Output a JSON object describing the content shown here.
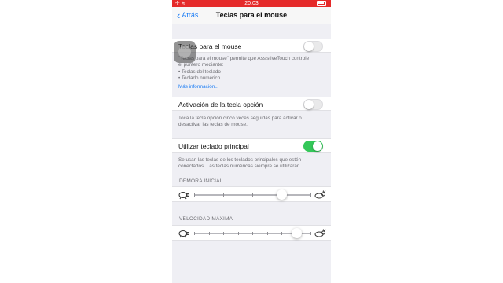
{
  "status_bar": {
    "time": "20:03",
    "left_icons": "✈ ≋"
  },
  "nav": {
    "back_label": "Atrás",
    "title": "Teclas para el mouse"
  },
  "mouse_keys": {
    "label": "Teclas para el mouse",
    "enabled": false,
    "footer_lines": [
      "\"Teclas para el mouse\" permite que AssistiveTouch controle",
      "el puntero mediante:",
      "•  Teclas del teclado",
      "•  Teclado numérico"
    ],
    "more_info_link": "Más información..."
  },
  "option_key": {
    "label": "Activación de la tecla opción",
    "enabled": false,
    "footer_lines": [
      "Toca la tecla opción cinco veces seguidas para activar o",
      "desactivar las teclas de mouse."
    ]
  },
  "primary_keyboard": {
    "label": "Utilizar teclado principal",
    "enabled": true,
    "footer_lines": [
      "Se usan las teclas de los teclados principales que estén",
      "conectados. Las teclas numéricas siempre se utilizarán."
    ]
  },
  "initial_delay": {
    "header": "DEMORA INICIAL",
    "value": 0.75,
    "ticks": 5,
    "icon_left": "turtle-icon",
    "icon_right": "rabbit-icon"
  },
  "max_speed": {
    "header": "VELOCIDAD MÁXIMA",
    "value": 0.88,
    "ticks": 9,
    "icon_left": "turtle-icon",
    "icon_right": "rabbit-icon"
  },
  "colors": {
    "status_bar": "#e52a2a",
    "accent": "#1a7cf5",
    "toggle_on": "#34c759",
    "background": "#efeff4"
  }
}
